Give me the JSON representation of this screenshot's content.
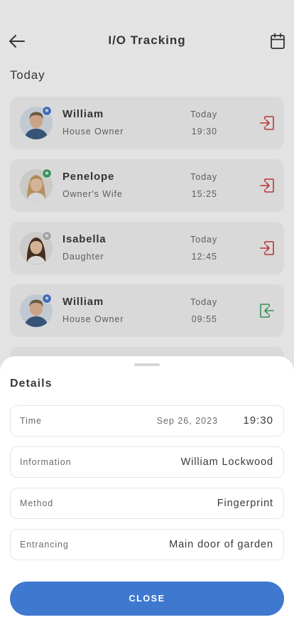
{
  "header": {
    "title": "I/O Tracking"
  },
  "section": {
    "title": "Today"
  },
  "records": [
    {
      "name": "William",
      "role": "House Owner",
      "day": "Today",
      "time": "19:30",
      "direction": "in",
      "badge_color": "#4a7bd0"
    },
    {
      "name": "Penelope",
      "role": "Owner's Wife",
      "day": "Today",
      "time": "15:25",
      "direction": "in",
      "badge_color": "#43a86b"
    },
    {
      "name": "Isabella",
      "role": "Daughter",
      "day": "Today",
      "time": "12:45",
      "direction": "in",
      "badge_color": "#b8b8b8"
    },
    {
      "name": "William",
      "role": "House Owner",
      "day": "Today",
      "time": "09:55",
      "direction": "out",
      "badge_color": "#4a7bd0"
    }
  ],
  "details": {
    "title": "Details",
    "time_label": "Time",
    "time_date": "Sep 26, 2023",
    "time_value": "19:30",
    "information_label": "Information",
    "information_value": "William Lockwood",
    "method_label": "Method",
    "method_value": "Fingerprint",
    "entrancing_label": "Entrancing",
    "entrancing_value": "Main door of garden",
    "close_label": "CLOSE"
  },
  "colors": {
    "accent": "#3f78cf",
    "enter_icon": "#d23c3c",
    "exit_icon": "#3da35f"
  },
  "icons": {
    "back": "arrow-left-icon",
    "calendar": "calendar-icon",
    "enter": "login-icon",
    "exit": "logout-icon"
  }
}
